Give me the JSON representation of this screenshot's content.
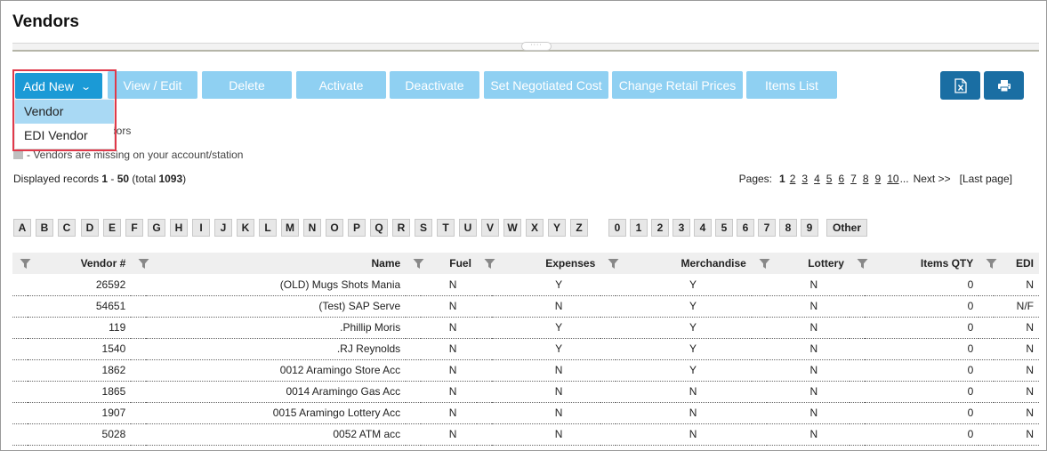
{
  "page": {
    "title": "Vendors"
  },
  "toolbar": {
    "add_new": "Add New",
    "buttons": [
      "View / Edit",
      "Delete",
      "Activate",
      "Deactivate",
      "Set Negotiated Cost",
      "Change Retail Prices",
      "Items List"
    ],
    "export_icon": "excel-export-icon",
    "print_icon": "print-icon"
  },
  "dropdown": {
    "items": [
      "Vendor",
      "EDI Vendor"
    ]
  },
  "legend": {
    "line1_tail": "dors",
    "line2": "- Vendors are missing on your account/station"
  },
  "records": {
    "prefix": "Displayed records ",
    "from": "1",
    "sep": " - ",
    "to": "50",
    "total_prefix": " (total ",
    "total": "1093",
    "suffix": ")"
  },
  "pager": {
    "label": "Pages:",
    "current": "1",
    "pages": [
      "2",
      "3",
      "4",
      "5",
      "6",
      "7",
      "8",
      "9",
      "10"
    ],
    "ellipsis": "...",
    "next": "Next >>",
    "last": "[Last page]"
  },
  "alphabet": [
    "A",
    "B",
    "C",
    "D",
    "E",
    "F",
    "G",
    "H",
    "I",
    "J",
    "K",
    "L",
    "M",
    "N",
    "O",
    "P",
    "Q",
    "R",
    "S",
    "T",
    "U",
    "V",
    "W",
    "X",
    "Y",
    "Z",
    "0",
    "1",
    "2",
    "3",
    "4",
    "5",
    "6",
    "7",
    "8",
    "9",
    "Other"
  ],
  "table": {
    "headers": [
      "Vendor #",
      "Name",
      "Fuel",
      "Expenses",
      "Merchandise",
      "Lottery",
      "Items QTY",
      "EDI"
    ],
    "rows": [
      [
        "26592",
        "(OLD) Mugs Shots Mania",
        "N",
        "Y",
        "Y",
        "N",
        "0",
        "N"
      ],
      [
        "54651",
        "(Test) SAP Serve",
        "N",
        "N",
        "Y",
        "N",
        "0",
        "N/F"
      ],
      [
        "119",
        ".Phillip Moris",
        "N",
        "Y",
        "Y",
        "N",
        "0",
        "N"
      ],
      [
        "1540",
        ".RJ Reynolds",
        "N",
        "Y",
        "Y",
        "N",
        "0",
        "N"
      ],
      [
        "1862",
        "0012 Aramingo Store Acc",
        "N",
        "N",
        "Y",
        "N",
        "0",
        "N"
      ],
      [
        "1865",
        "0014 Aramingo Gas Acc",
        "N",
        "N",
        "N",
        "N",
        "0",
        "N"
      ],
      [
        "1907",
        "0015 Aramingo Lottery Acc",
        "N",
        "N",
        "N",
        "N",
        "0",
        "N"
      ],
      [
        "5028",
        "0052 ATM acc",
        "N",
        "N",
        "N",
        "N",
        "0",
        "N"
      ]
    ]
  }
}
